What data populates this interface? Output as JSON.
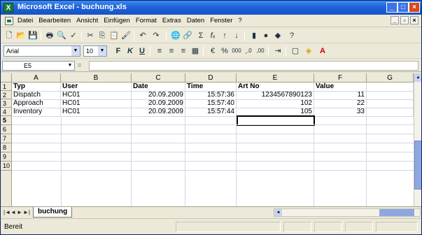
{
  "window": {
    "title": "Microsoft Excel - buchung.xls",
    "app_icon": "X",
    "controls": [
      "_",
      "□",
      "×"
    ]
  },
  "menubar": {
    "items": [
      "Datei",
      "Bearbeiten",
      "Ansicht",
      "Einfügen",
      "Format",
      "Extras",
      "Daten",
      "Fenster",
      "?"
    ],
    "doc_controls": [
      "_",
      "▫",
      "×"
    ]
  },
  "format_toolbar": {
    "font_name": "Arial",
    "font_size": "10",
    "bold": "F",
    "italic": "K",
    "underline": "U",
    "currency": "%",
    "thousands": "000",
    "dec_inc": "¸,0",
    "dec_dec": ",00"
  },
  "formula_bar": {
    "name_box": "E5",
    "fx": "=",
    "value": ""
  },
  "sheet": {
    "columns": [
      "A",
      "B",
      "C",
      "D",
      "E",
      "F",
      "G"
    ],
    "row_numbers": [
      "1",
      "2",
      "3",
      "4",
      "5",
      "6",
      "7",
      "8",
      "9",
      "10"
    ],
    "header_row": [
      "Typ",
      "User",
      "Date",
      "Time",
      "Art No",
      "Value"
    ],
    "rows": [
      [
        "Dispatch",
        "HC01",
        "20.09.2009",
        "15:57:36",
        "1234567890123",
        "11"
      ],
      [
        "Approach",
        "HC01",
        "20.09.2009",
        "15:57:40",
        "102",
        "22"
      ],
      [
        "Inventory",
        "HC01",
        "20.09.2009",
        "15:57:44",
        "105",
        "33"
      ]
    ],
    "active_cell": "E5"
  },
  "tabs": {
    "nav": [
      "|◄",
      "◄",
      "►",
      "►|"
    ],
    "sheet_name": "buchung"
  },
  "status": {
    "text": "Bereit"
  }
}
